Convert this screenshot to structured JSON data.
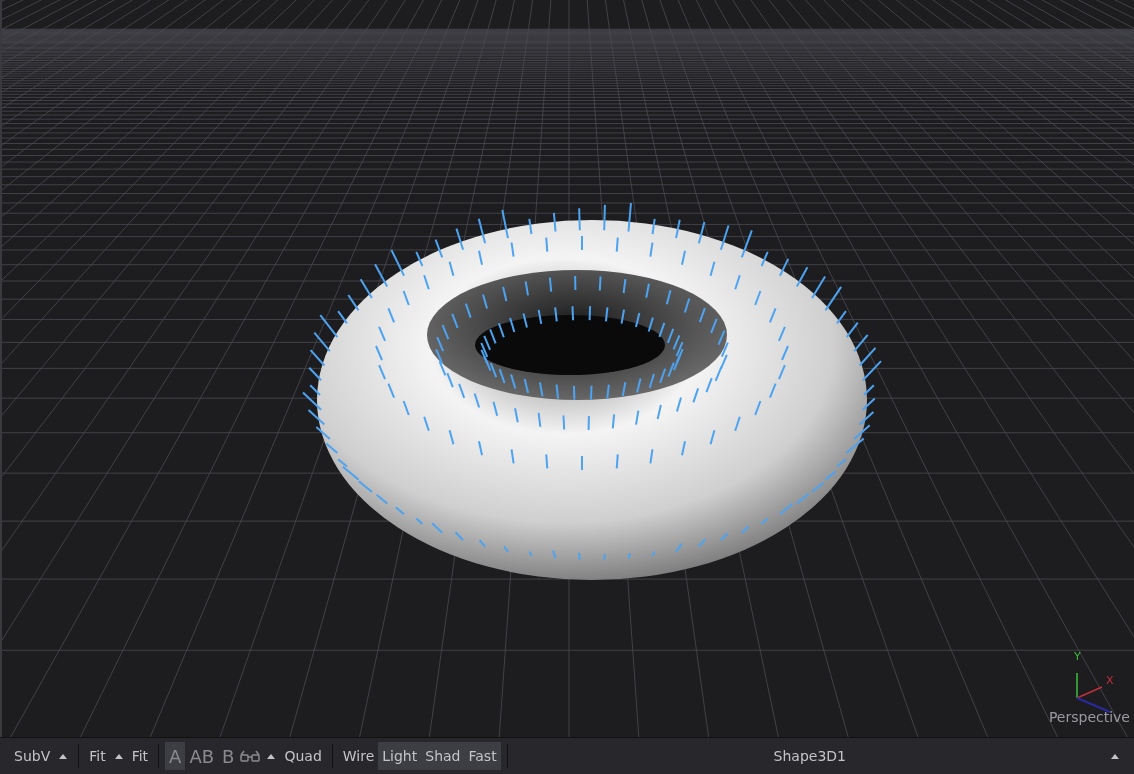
{
  "viewport": {
    "axis_y": "Y",
    "axis_x": "X",
    "camera": "Perspective"
  },
  "toolbar": {
    "items": [
      {
        "kind": "button",
        "label": "SubV",
        "selected": false
      },
      {
        "kind": "caret"
      },
      {
        "kind": "separator"
      },
      {
        "kind": "button",
        "label": "Fit",
        "selected": false
      },
      {
        "kind": "caret"
      },
      {
        "kind": "button",
        "label": "Fit",
        "selected": false
      },
      {
        "kind": "separator"
      },
      {
        "kind": "toggle",
        "label": "A",
        "selected": true
      },
      {
        "kind": "toggle",
        "label": "AB",
        "selected": false
      },
      {
        "kind": "toggle",
        "label": "B",
        "selected": false
      },
      {
        "kind": "glasses"
      },
      {
        "kind": "caret"
      },
      {
        "kind": "button",
        "label": "Quad",
        "selected": false
      },
      {
        "kind": "separator"
      },
      {
        "kind": "button",
        "label": "Wire",
        "selected": false
      },
      {
        "kind": "button",
        "label": "Light",
        "selected": true
      },
      {
        "kind": "button",
        "label": "Shad",
        "selected": true
      },
      {
        "kind": "button",
        "label": "Fast",
        "selected": true
      },
      {
        "kind": "separator"
      }
    ],
    "title": "Shape3D1"
  }
}
